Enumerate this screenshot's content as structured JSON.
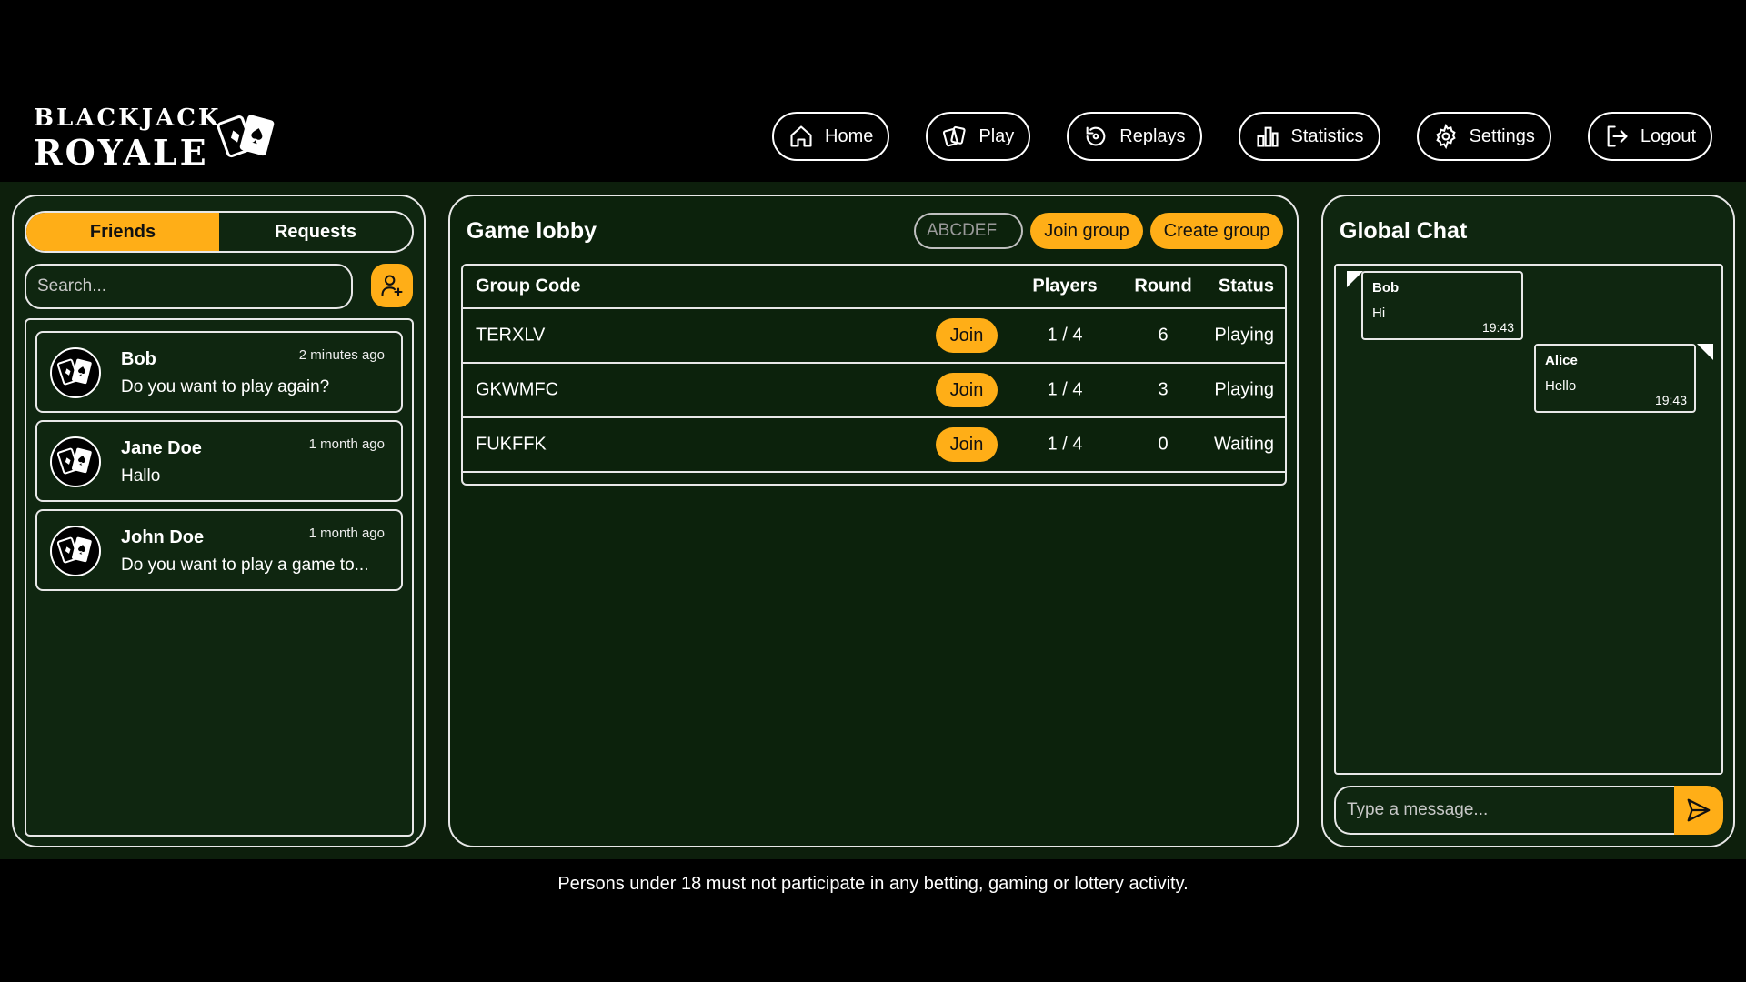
{
  "brand": {
    "line1": "BLACKJACK",
    "line2": "ROYALE"
  },
  "nav": [
    {
      "label": "Home",
      "icon": "home-icon"
    },
    {
      "label": "Play",
      "icon": "cards-icon"
    },
    {
      "label": "Replays",
      "icon": "replay-icon"
    },
    {
      "label": "Statistics",
      "icon": "bar-chart-icon"
    },
    {
      "label": "Settings",
      "icon": "gear-icon"
    },
    {
      "label": "Logout",
      "icon": "logout-icon"
    }
  ],
  "friends_panel": {
    "tabs": {
      "friends": "Friends",
      "requests": "Requests"
    },
    "search_placeholder": "Search...",
    "friends": [
      {
        "name": "Bob",
        "time": "2 minutes ago",
        "message": "Do you want to play again?"
      },
      {
        "name": "Jane Doe",
        "time": "1 month ago",
        "message": "Hallo"
      },
      {
        "name": "John Doe",
        "time": "1 month ago",
        "message": "Do you want to play a game to..."
      }
    ]
  },
  "lobby": {
    "title": "Game lobby",
    "code_placeholder": "ABCDEF",
    "join_group": "Join group",
    "create_group": "Create group",
    "columns": {
      "code": "Group Code",
      "players": "Players",
      "round": "Round",
      "status": "Status"
    },
    "join_label": "Join",
    "rows": [
      {
        "code": "TERXLV",
        "players": "1 / 4",
        "round": "6",
        "status": "Playing"
      },
      {
        "code": "GKWMFC",
        "players": "1 / 4",
        "round": "3",
        "status": "Playing"
      },
      {
        "code": "FUKFFK",
        "players": "1 / 4",
        "round": "0",
        "status": "Waiting"
      }
    ]
  },
  "chat": {
    "title": "Global Chat",
    "messages": [
      {
        "author": "Bob",
        "text": "Hi",
        "time": "19:43"
      },
      {
        "author": "Alice",
        "text": "Hello",
        "time": "19:43"
      }
    ],
    "input_placeholder": "Type a message..."
  },
  "footer": {
    "disclaimer": "Persons under 18 must not participate in any betting, gaming or lottery activity."
  },
  "colors": {
    "accent": "#ffae17",
    "panel": "#0f2610",
    "background": "#000000"
  }
}
